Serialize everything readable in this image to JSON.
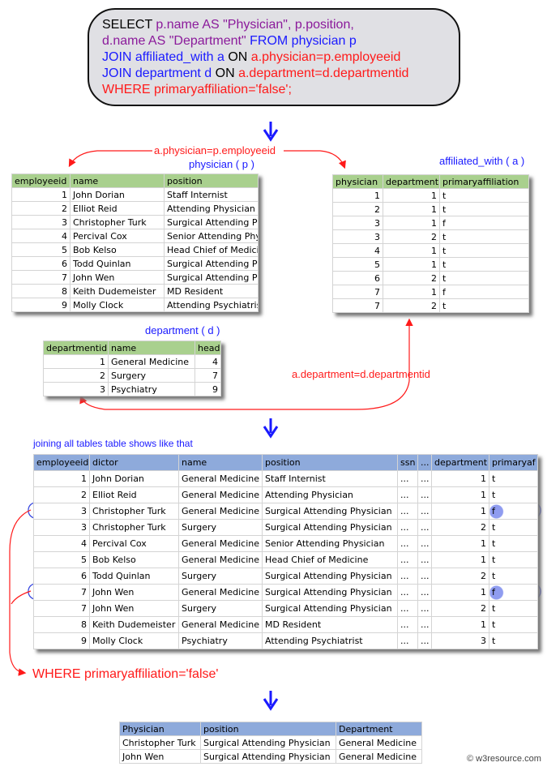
{
  "sql": [
    [
      {
        "t": "SELECT ",
        "c": "#000000"
      },
      {
        "t": "p.name AS \"Physician\", p.position,",
        "c": "#8b1a9b"
      }
    ],
    [
      {
        "t": "d.name AS \"Department\" ",
        "c": "#8b1a9b"
      },
      {
        "t": "FROM physician p",
        "c": "#1a1aff"
      }
    ],
    [
      {
        "t": "JOIN affiliated_with a ",
        "c": "#1a1aff"
      },
      {
        "t": "ON ",
        "c": "#000000"
      },
      {
        "t": "a.physician=p.employeeid",
        "c": "#ff1a1a"
      }
    ],
    [
      {
        "t": "JOIN department d ",
        "c": "#1a1aff"
      },
      {
        "t": "ON ",
        "c": "#000000"
      },
      {
        "t": "a.department=d.departmentid",
        "c": "#ff1a1a"
      }
    ],
    [
      {
        "t": "WHERE primaryaffiliation='false';",
        "c": "#ff1a1a"
      }
    ]
  ],
  "labels": {
    "join1": "a.physician=p.employeeid",
    "join2": "a.department=d.departmentid",
    "physician_title": "physician ( p )",
    "affiliated_title": "affiliated_with ( a )",
    "department_title": "department ( d )",
    "joined_caption": "joining all tables table shows like that",
    "where": "WHERE primaryaffiliation='false'",
    "copyright": "© w3resource.com"
  },
  "colors": {
    "green_header": "#a9d08e",
    "blue_header": "#8eaadb",
    "red": "#ff1a1a",
    "blue": "#1a1aff"
  },
  "physician": {
    "columns": [
      "employeeid",
      "name",
      "position"
    ],
    "rows": [
      [
        "1",
        "John Dorian",
        "Staff Internist"
      ],
      [
        "2",
        "Elliot Reid",
        "Attending Physician"
      ],
      [
        "3",
        "Christopher Turk",
        "Surgical Attending Ph"
      ],
      [
        "4",
        "Percival Cox",
        "Senior Attending Phys"
      ],
      [
        "5",
        "Bob Kelso",
        "Head Chief of Medici"
      ],
      [
        "6",
        "Todd Quinlan",
        "Surgical Attending Ph"
      ],
      [
        "7",
        "John Wen",
        "Surgical Attending Ph"
      ],
      [
        "8",
        "Keith Dudemeister",
        "MD Resident"
      ],
      [
        "9",
        "Molly Clock",
        "Attending Psychiatris"
      ]
    ]
  },
  "affiliated_with": {
    "columns": [
      "physician",
      "department",
      "primaryaffiliation"
    ],
    "rows": [
      [
        "1",
        "1",
        "t"
      ],
      [
        "2",
        "1",
        "t"
      ],
      [
        "3",
        "1",
        "f"
      ],
      [
        "3",
        "2",
        "t"
      ],
      [
        "4",
        "1",
        "t"
      ],
      [
        "5",
        "1",
        "t"
      ],
      [
        "6",
        "2",
        "t"
      ],
      [
        "7",
        "1",
        "f"
      ],
      [
        "7",
        "2",
        "t"
      ]
    ]
  },
  "department": {
    "columns": [
      "departmentid",
      "name",
      "head"
    ],
    "rows": [
      [
        "1",
        "General Medicine",
        "4"
      ],
      [
        "2",
        "Surgery",
        "7"
      ],
      [
        "3",
        "Psychiatry",
        "9"
      ]
    ]
  },
  "joined": {
    "columns": [
      "employeeid",
      "dictor",
      "name",
      "position",
      "ssn",
      "...",
      "department",
      "primaryaf"
    ],
    "rows": [
      [
        "1",
        "John Dorian",
        "General Medicine",
        "Staff Internist",
        "...",
        "...",
        "1",
        "t"
      ],
      [
        "2",
        "Elliot Reid",
        "General Medicine",
        "Attending Physician",
        "...",
        "...",
        "1",
        "t"
      ],
      [
        "3",
        "Christopher Turk",
        "General Medicine",
        "Surgical Attending Physician",
        "...",
        "...",
        "1",
        "f"
      ],
      [
        "3",
        "Christopher Turk",
        "Surgery",
        "Surgical Attending Physician",
        "...",
        "...",
        "2",
        "t"
      ],
      [
        "4",
        "Percival Cox",
        "General Medicine",
        "Senior Attending Physician",
        "...",
        "...",
        "1",
        "t"
      ],
      [
        "5",
        "Bob Kelso",
        "General Medicine",
        "Head Chief of Medicine",
        "...",
        "...",
        "1",
        "t"
      ],
      [
        "6",
        "Todd Quinlan",
        "Surgery",
        "Surgical Attending Physician",
        "...",
        "...",
        "2",
        "t"
      ],
      [
        "7",
        "John Wen",
        "General Medicine",
        "Surgical Attending Physician",
        "...",
        "...",
        "1",
        "f"
      ],
      [
        "7",
        "John Wen",
        "Surgery",
        "Surgical Attending Physician",
        "...",
        "...",
        "2",
        "t"
      ],
      [
        "8",
        "Keith Dudemeister",
        "General Medicine",
        "MD Resident",
        "...",
        "...",
        "1",
        "t"
      ],
      [
        "9",
        "Molly Clock",
        "Psychiatry",
        "Attending Psychiatrist",
        "...",
        "...",
        "3",
        "t"
      ]
    ]
  },
  "result": {
    "columns": [
      "Physician",
      "position",
      "Department"
    ],
    "rows": [
      [
        "Christopher Turk",
        "Surgical Attending Physician",
        "General Medicine"
      ],
      [
        "John Wen",
        "Surgical Attending Physician",
        "General Medicine"
      ]
    ]
  }
}
